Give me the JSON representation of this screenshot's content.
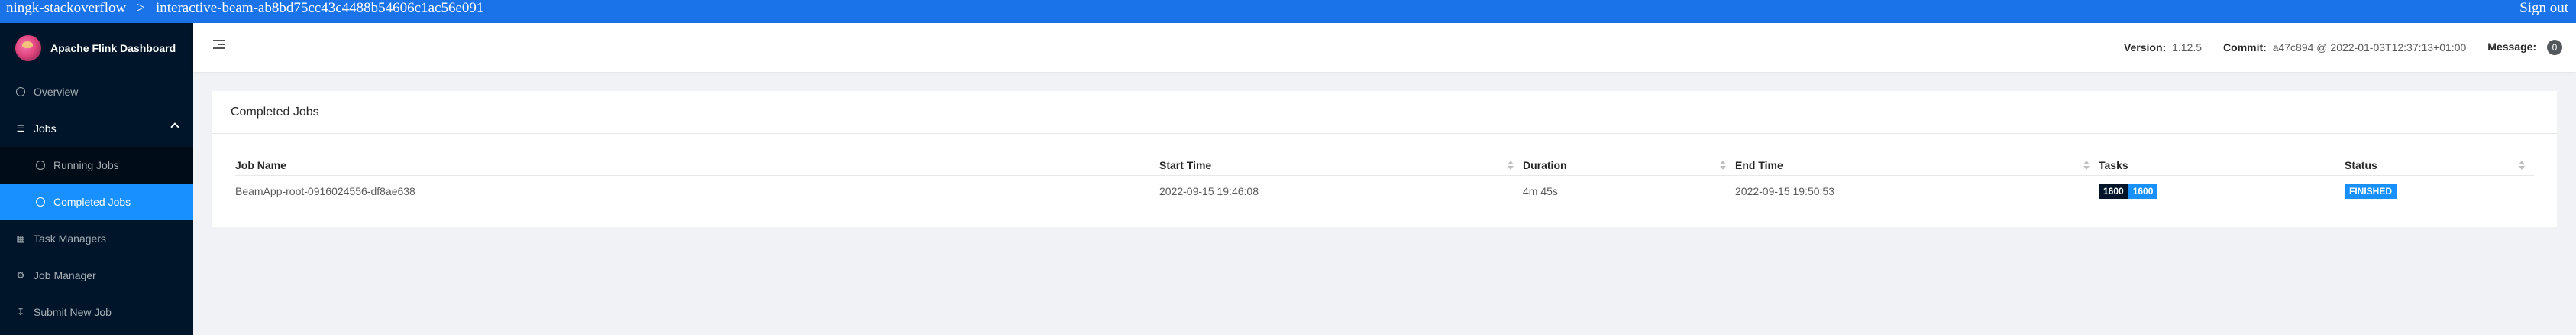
{
  "topbar": {
    "crumb1": "ningk-stackoverflow",
    "separator": ">",
    "crumb2": "interactive-beam-ab8bd75cc43c4488b54606c1ac56e091",
    "signout": "Sign out",
    "color": "#1a73e8"
  },
  "brand": {
    "title": "Apache Flink Dashboard"
  },
  "sidebar": {
    "items": [
      {
        "label": "Overview",
        "icon": "dashboard-icon"
      },
      {
        "label": "Jobs",
        "icon": "bars-icon"
      },
      {
        "label": "Running Jobs",
        "icon": "play-circle-icon"
      },
      {
        "label": "Completed Jobs",
        "icon": "check-circle-icon"
      },
      {
        "label": "Task Managers",
        "icon": "schedule-icon"
      },
      {
        "label": "Job Manager",
        "icon": "build-icon"
      },
      {
        "label": "Submit New Job",
        "icon": "upload-icon"
      }
    ]
  },
  "header": {
    "version_label": "Version:",
    "version_value": "1.12.5",
    "commit_label": "Commit:",
    "commit_value": "a47c894 @ 2022-01-03T12:37:13+01:00",
    "message_label": "Message:",
    "message_count": "0"
  },
  "card": {
    "title": "Completed Jobs",
    "columns": [
      "Job Name",
      "Start Time",
      "Duration",
      "End Time",
      "Tasks",
      "Status"
    ],
    "rows": [
      {
        "job_name": "BeamApp-root-0916024556-df8ae638",
        "start_time": "2022-09-15 19:46:08",
        "duration": "4m 45s",
        "end_time": "2022-09-15 19:50:53",
        "tasks_total": "1600",
        "tasks_finished": "1600",
        "status": "FINISHED"
      }
    ]
  },
  "colors": {
    "sidebar": "#001529",
    "accent": "#1890ff"
  }
}
